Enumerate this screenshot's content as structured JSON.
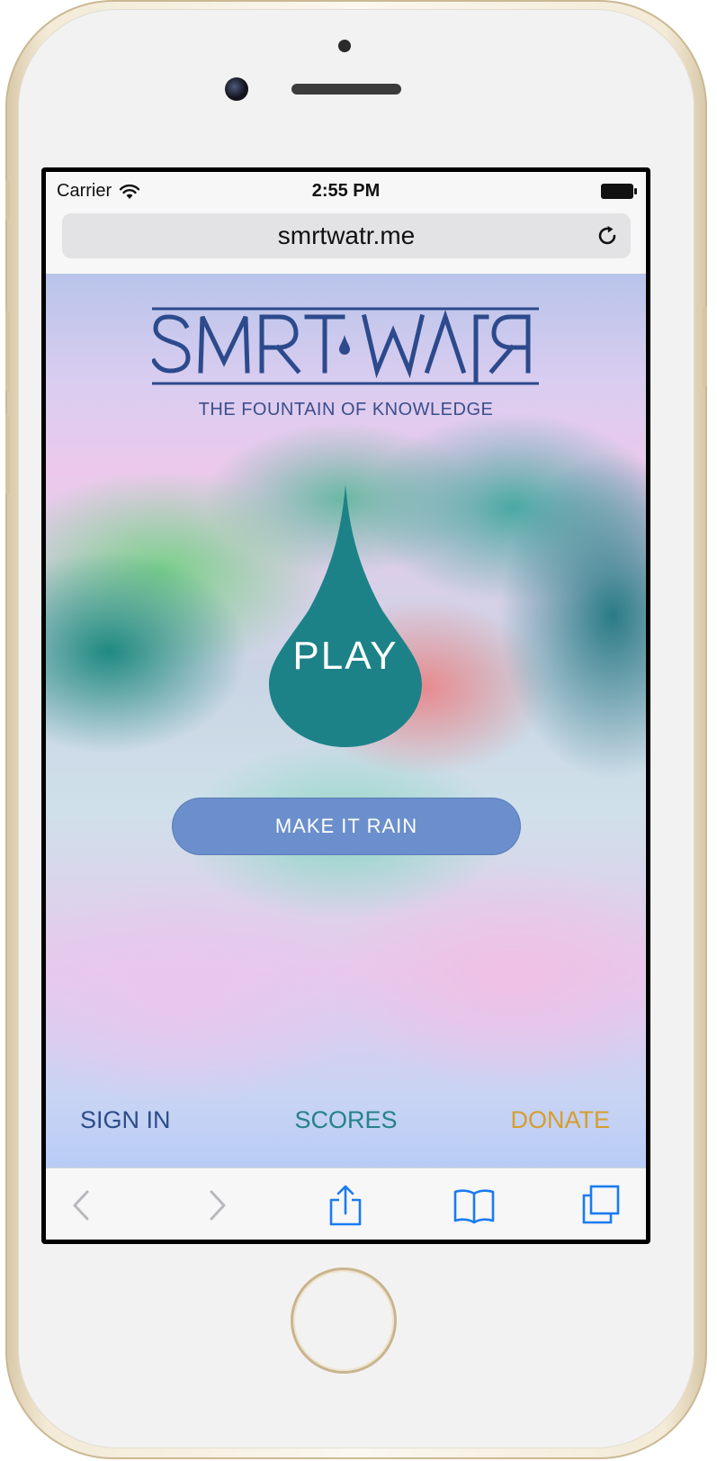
{
  "status_bar": {
    "carrier": "Carrier",
    "time": "2:55 PM",
    "wifi_icon": "wifi-icon",
    "battery_icon": "battery-icon"
  },
  "browser": {
    "url": "smrtwatr.me",
    "reload_icon": "reload-icon",
    "toolbar": [
      "back-icon",
      "forward-icon",
      "share-icon",
      "bookmarks-icon",
      "tabs-icon"
    ]
  },
  "page": {
    "logo_text": "SMRT WATR",
    "tagline": "THE FOUNTAIN OF KNOWLEDGE",
    "play_label": "PLAY",
    "rain_button": "MAKE IT RAIN",
    "footer": {
      "sign_in": "SIGN IN",
      "scores": "SCORES",
      "donate": "DONATE"
    }
  },
  "colors": {
    "logo_blue": "#2c4a8c",
    "drop_teal": "#1c8288",
    "button_blue": "#6b8fcc",
    "donate_gold": "#d79d2c",
    "scores_teal": "#25828a",
    "toolbar_icon_blue": "#1a7bf0"
  }
}
